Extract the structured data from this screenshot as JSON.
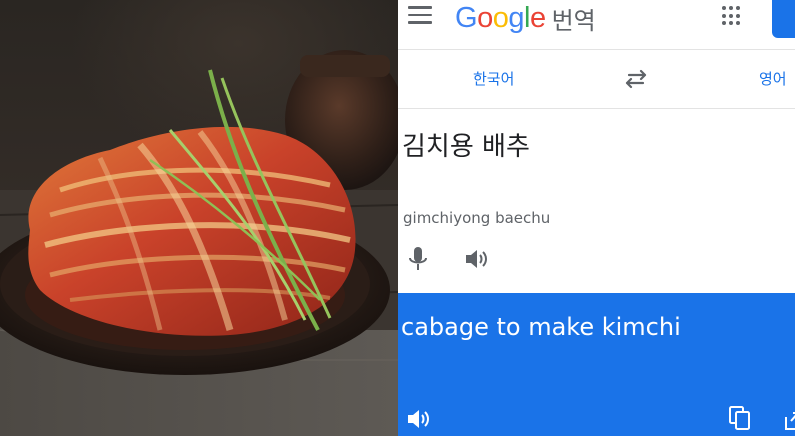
{
  "header": {
    "menu_icon": "hamburger-menu-icon",
    "logo": {
      "letters": [
        {
          "char": "G",
          "color": "#4285F4"
        },
        {
          "char": "o",
          "color": "#EA4335"
        },
        {
          "char": "o",
          "color": "#FBBC05"
        },
        {
          "char": "g",
          "color": "#4285F4"
        },
        {
          "char": "l",
          "color": "#34A853"
        },
        {
          "char": "e",
          "color": "#EA4335"
        }
      ],
      "product": "번역"
    },
    "apps_icon": "apps-grid-icon"
  },
  "languages": {
    "source": "한국어",
    "target": "영어",
    "swap_icon": "swap-arrows-icon"
  },
  "input": {
    "text": "김치용 배추",
    "romanization": "gimchiyong baechu"
  },
  "output": {
    "text": "cabage to make kimchi"
  },
  "colors": {
    "accent": "#1a73e8",
    "secondary_text": "#5f6368"
  },
  "photo": {
    "subject": "kimchi-cabbage-photo"
  }
}
